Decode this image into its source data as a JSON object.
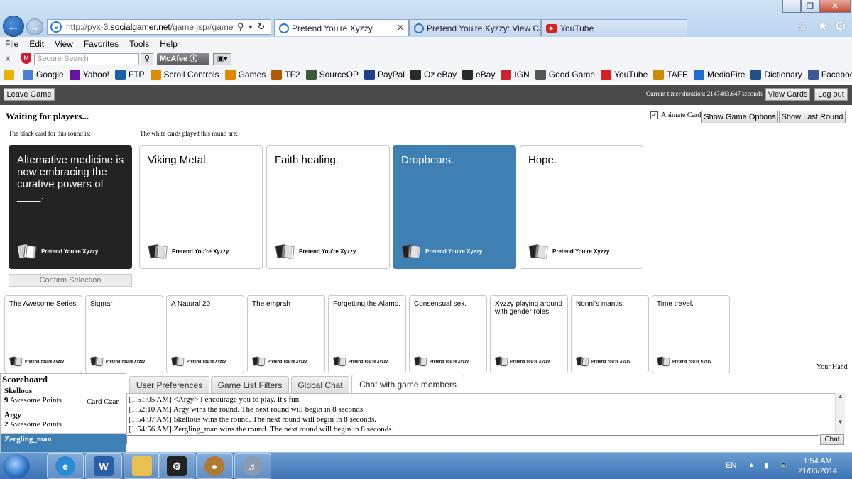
{
  "browser": {
    "address_prefix": "http://pyx-3.",
    "address_domain": "socialgamer.net",
    "address_suffix": "/game.jsp#game=",
    "tabs": [
      {
        "label": "Pretend You're Xyzzy"
      },
      {
        "label": "Pretend You're Xyzzy: View Car..."
      },
      {
        "label": "YouTube"
      }
    ],
    "menu": [
      "File",
      "Edit",
      "View",
      "Favorites",
      "Tools",
      "Help"
    ],
    "toolbar": {
      "close": "x",
      "search_placeholder": "Secure Search",
      "mcafee": "McAfee"
    },
    "favorites": [
      {
        "label": "",
        "icon": "star-icon",
        "color": "#e8b400"
      },
      {
        "label": "Google",
        "icon": "google-icon",
        "color": "#4a7fd8"
      },
      {
        "label": "Yahoo!",
        "icon": "yahoo-icon",
        "color": "#6b0fa8"
      },
      {
        "label": "FTP",
        "icon": "ftp-icon",
        "color": "#1f5fa8"
      },
      {
        "label": "Scroll Controls",
        "icon": "scroll-icon",
        "color": "#e08a00"
      },
      {
        "label": "Games",
        "icon": "games-icon",
        "color": "#e08a00"
      },
      {
        "label": "TF2",
        "icon": "tf2-icon",
        "color": "#b35a00"
      },
      {
        "label": "SourceOP",
        "icon": "sourceop-icon",
        "color": "#3a5a3a"
      },
      {
        "label": "PayPal",
        "icon": "paypal-icon",
        "color": "#1f3f8a"
      },
      {
        "label": "Oz eBay",
        "icon": "ebay-icon",
        "color": "#2a2a2a"
      },
      {
        "label": "eBay",
        "icon": "ebay-icon",
        "color": "#2a2a2a"
      },
      {
        "label": "IGN",
        "icon": "ign-icon",
        "color": "#d0202a"
      },
      {
        "label": "Good Game",
        "icon": "goodgame-icon",
        "color": "#555555"
      },
      {
        "label": "YouTube",
        "icon": "youtube-icon",
        "color": "#d81e1e"
      },
      {
        "label": "TAFE",
        "icon": "tafe-icon",
        "color": "#d08a00"
      },
      {
        "label": "MediaFire",
        "icon": "mediafire-icon",
        "color": "#1f6fd0"
      },
      {
        "label": "Dictionary",
        "icon": "dictionary-icon",
        "color": "#1f4f8a"
      },
      {
        "label": "Facebook",
        "icon": "facebook-icon",
        "color": "#3b5998"
      }
    ]
  },
  "game": {
    "leave": "Leave Game",
    "timer": "Current timer duration: 2147483.647 seconds",
    "view_cards": "View Cards",
    "logout": "Log out",
    "status": "Waiting for players...",
    "black_label": "The black card for this round is:",
    "white_label": "The white cards played this round are:",
    "animate_label": "Animate Cards",
    "show_options": "Show Game Options",
    "show_last": "Show Last Round",
    "black_card": "Alternative medicine is now embracing the curative powers of ____.",
    "brand": "Pretend You're Xyzzy",
    "played": [
      "Viking Metal.",
      "Faith healing.",
      "Dropbears.",
      "Hope."
    ],
    "confirm": "Confirm Selection",
    "hand": [
      "The Awesome Series.",
      "Sigmar",
      "A Natural 20",
      "The emprah",
      "Forgetting the Alamo.",
      "Consensual sex.",
      "Xyzzy playing around with gender roles.",
      "Nonni's mantis.",
      "Time travel."
    ],
    "your_hand": "Your Hand"
  },
  "scoreboard": {
    "title": "Scoreboard",
    "players": [
      {
        "name": "Skellous",
        "points": "9",
        "unit": "Awesome Points",
        "status": "Card Czar"
      },
      {
        "name": "Argy",
        "points": "2",
        "unit": "Awesome Points",
        "status": ""
      },
      {
        "name": "Zergling_man",
        "points": "",
        "unit": "",
        "status": ""
      }
    ]
  },
  "chat": {
    "tabs": [
      "User Preferences",
      "Game List Filters",
      "Global Chat",
      "Chat with game members"
    ],
    "messages": [
      "[1:51:05 AM] <Argy> I encourage you to play. It's fun.",
      "[1:52:10 AM] Argy wins the round. The next round will begin in 8 seconds.",
      "[1:54:07 AM] Skellous wins the round. The next round will begin in 8 seconds.",
      "[1:54:56 AM] Zergling_man wins the round. The next round will begin in 8 seconds."
    ],
    "send": "Chat"
  },
  "taskbar": {
    "lang": "EN",
    "time": "1:54 AM",
    "date": "21/06/2014"
  }
}
